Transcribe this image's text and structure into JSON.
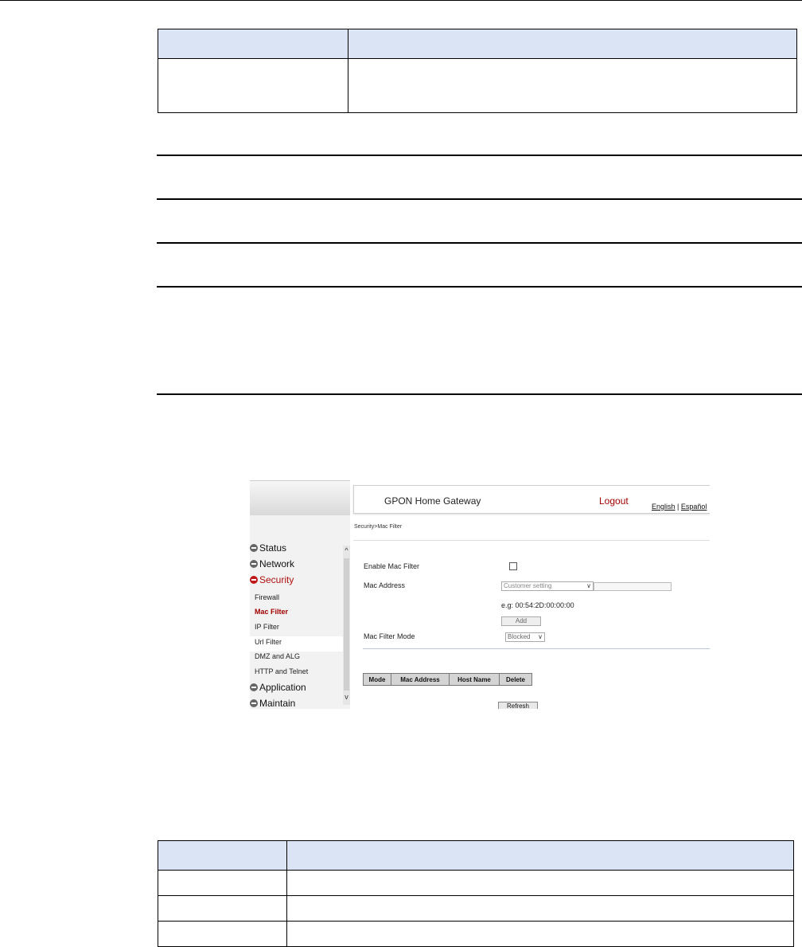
{
  "figure": {
    "header": {
      "brand": "GPON Home Gateway",
      "logout": "Logout",
      "lang_english": "English",
      "lang_separator": "|",
      "lang_spanish": "Español"
    },
    "breadcrumb": "Security>Mac Filter",
    "sidebar": {
      "top_items": [
        {
          "label": "Status"
        },
        {
          "label": "Network"
        },
        {
          "label": "Security"
        },
        {
          "label": "Application"
        },
        {
          "label": "Maintain"
        }
      ],
      "sub_items": [
        {
          "label": "Firewall"
        },
        {
          "label": "Mac Filter"
        },
        {
          "label": "IP Filter"
        },
        {
          "label": "Url Filter"
        },
        {
          "label": "DMZ and ALG"
        },
        {
          "label": "HTTP and Telnet"
        }
      ],
      "scroll_up": "^",
      "scroll_down": "v"
    },
    "form": {
      "enable_label": "Enable Mac Filter",
      "mac_label": "Mac Address",
      "mac_select_value": "Customer setting",
      "example": "e.g: 00:54:2D:00:00:00",
      "add_button": "Add",
      "mode_label": "Mac Filter Mode",
      "mode_value": "Blocked"
    },
    "table_headers": [
      "Mode",
      "Mac Address",
      "Host Name",
      "Delete"
    ],
    "refresh_button": "Refresh",
    "chevron": "∨"
  }
}
